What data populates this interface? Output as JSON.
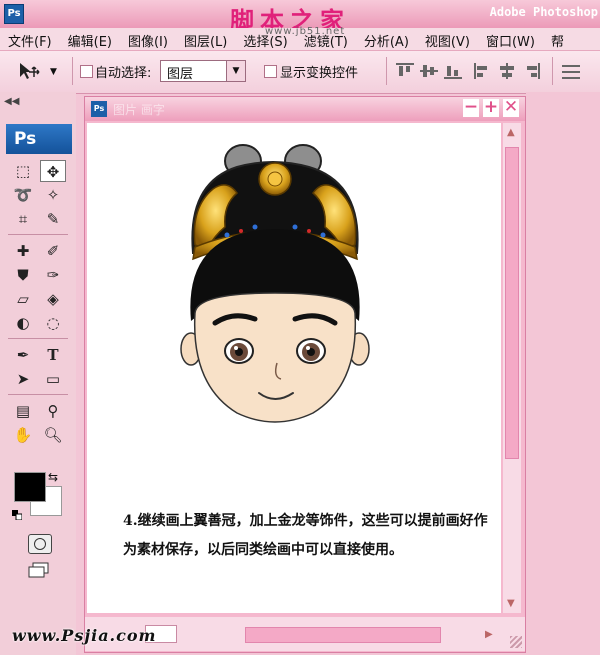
{
  "titlebar": {
    "site_banner": "脚本之家",
    "site_url": "www.jb51.net",
    "app_name": "Adobe Photoshop",
    "logo": "Ps"
  },
  "menu": [
    "文件(F)",
    "编辑(E)",
    "图像(I)",
    "图层(L)",
    "选择(S)",
    "滤镜(T)",
    "分析(A)",
    "视图(V)",
    "窗口(W)",
    "帮"
  ],
  "options": {
    "auto_select_label": "自动选择:",
    "auto_select_checked": false,
    "layer_select_value": "图层",
    "show_transform_label": "显示变换控件",
    "show_transform_checked": false
  },
  "tools": {
    "badge": "Ps",
    "foreground": "#000000",
    "background": "#ffffff"
  },
  "document": {
    "title": "图片 画字",
    "canvas_caption": "4.继续画上翼善冠，加上金龙等饰件，这些可以提前画好作为素材保存，以后同类绘画中可以直接使用。"
  },
  "watermark": "www.Psjia.com",
  "colors": {
    "accent": "#e0217a",
    "chrome_pink": "#f3c6d6",
    "ps_blue": "#1d5fa8"
  }
}
